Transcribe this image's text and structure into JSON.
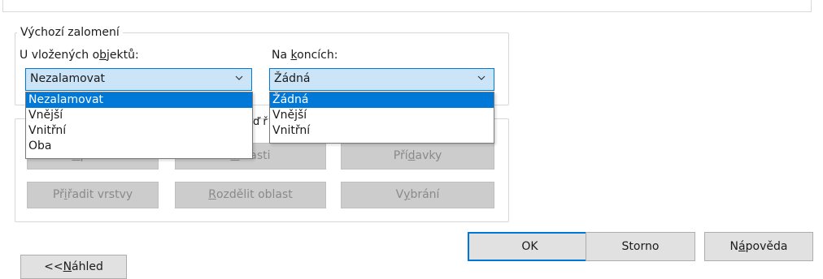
{
  "wrap": {
    "group_title": "Výchozí zalomení",
    "embedded_label_pre": "U vložených o",
    "embedded_label_key": "b",
    "embedded_label_post": "jektů:",
    "ends_label_pre": "Na ",
    "ends_label_key": "k",
    "ends_label_post": "oncích:",
    "embedded_selected": "Nezalamovat",
    "ends_selected": "Žádná",
    "embedded_options": [
      "Nezalamovat",
      "Vnější",
      "Vnitřní",
      "Oba"
    ],
    "ends_options": [
      "Žádná",
      "Vnější",
      "Vnitřní"
    ],
    "hidden_fragment": "ď ř"
  },
  "buttons": {
    "edit_pre": "",
    "edit_key": "Ú",
    "edit_post": "pravit",
    "areas_pre": "",
    "areas_key": "O",
    "areas_post": "blasti",
    "suffixes_pre": "Pří",
    "suffixes_key": "d",
    "suffixes_post": "avky",
    "assign_pre": "Př",
    "assign_key": "i",
    "assign_post": "řadit vrstvy",
    "split_pre": "",
    "split_key": "R",
    "split_post": "ozdělit oblast",
    "selection_pre": "V",
    "selection_key": "y",
    "selection_post": "brání"
  },
  "dialog": {
    "ok": "OK",
    "cancel": "Storno",
    "help_pre": "N",
    "help_key": "á",
    "help_post": "pověda",
    "preview_pre": "<< ",
    "preview_key": "N",
    "preview_post": "áhled"
  },
  "colors": {
    "accent": "#0078d7",
    "combo_fill": "#cce4f7"
  }
}
